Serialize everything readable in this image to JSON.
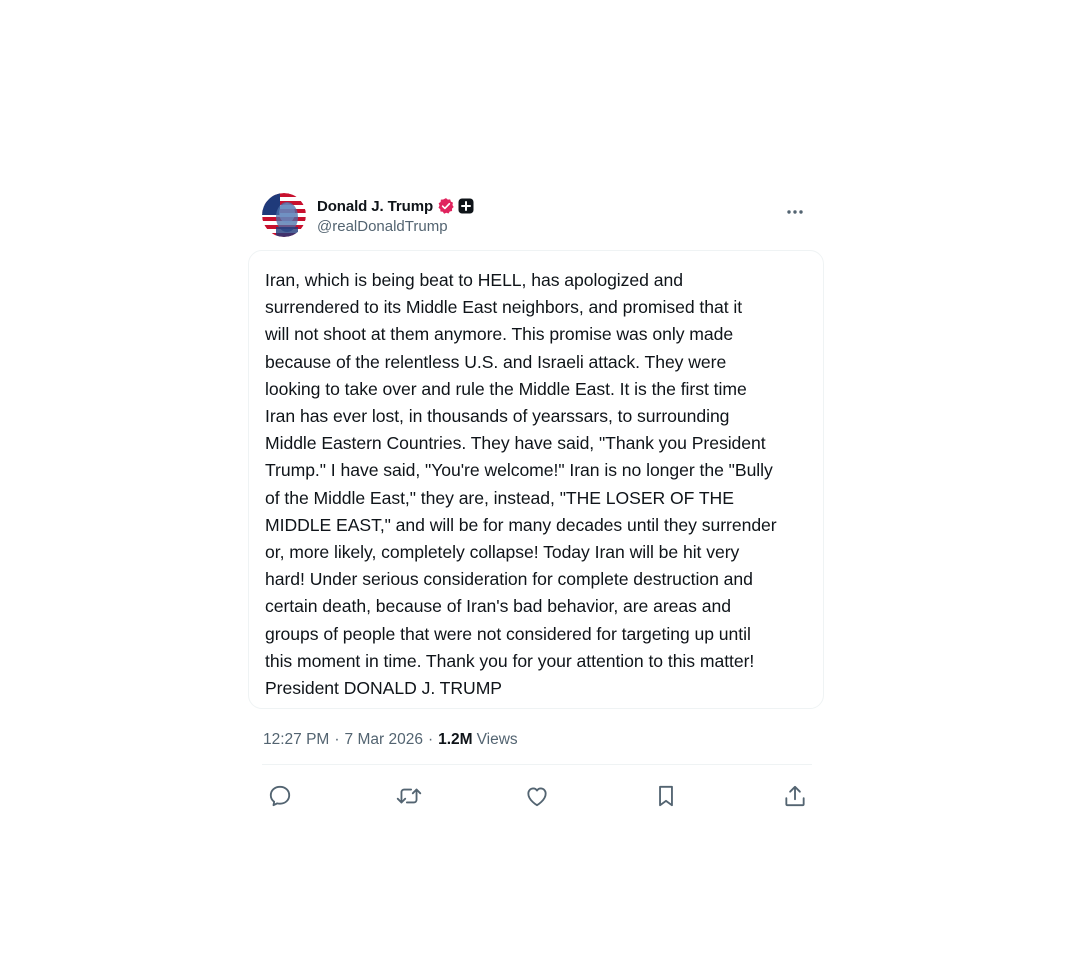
{
  "post": {
    "author": {
      "display_name": "Donald J. Trump",
      "handle": "@realDonaldTrump",
      "avatar_icon": "avatar-flag-portrait",
      "verified_icon": "verified-badge-icon",
      "affiliate_icon": "affiliate-plus-icon",
      "verified_color": "#e0245e"
    },
    "more_icon": "more-horizontal-icon",
    "text": "Iran, which is being beat to HELL, has apologized and\nsurrendered to its Middle East neighbors, and promised that it\nwill not shoot at them anymore. This promise was only made\nbecause of the relentless U.S. and Israeli attack. They were\nlooking to take over and rule the Middle East. It is the first time\nIran has  ever lost, in thousands of yearssars, to surrounding\nMiddle Eastern Countries. They have said, \"Thank you President\nTrump.\" I have said, \"You're welcome!\" Iran is no longer the \"Bully\nof the Middle East,\" they are, instead, \"THE LOSER OF THE\nMIDDLE EAST,\" and will be for many decades until they surrender\nor, more likely, completely collapse! Today Iran will be hit very\nhard! Under serious consideration for complete destruction and\ncertain death, because of Iran's bad behavior, are areas and\ngroups of people that were not considered for targeting up until\nthis moment in time. Thank you for your attention to this matter!\nPresident DONALD J. TRUMP",
    "meta": {
      "time": "12:27 PM",
      "separator": "·",
      "date": "7 Mar 2026",
      "views_count": "1.2M",
      "views_label": "Views"
    },
    "actions": [
      {
        "name": "reply",
        "icon": "reply-icon"
      },
      {
        "name": "repost",
        "icon": "repost-icon"
      },
      {
        "name": "like",
        "icon": "like-icon"
      },
      {
        "name": "bookmark",
        "icon": "bookmark-icon"
      },
      {
        "name": "share",
        "icon": "share-icon"
      }
    ],
    "colors": {
      "text": "#0f1419",
      "secondary": "#536471",
      "border": "#eff3f4"
    }
  }
}
